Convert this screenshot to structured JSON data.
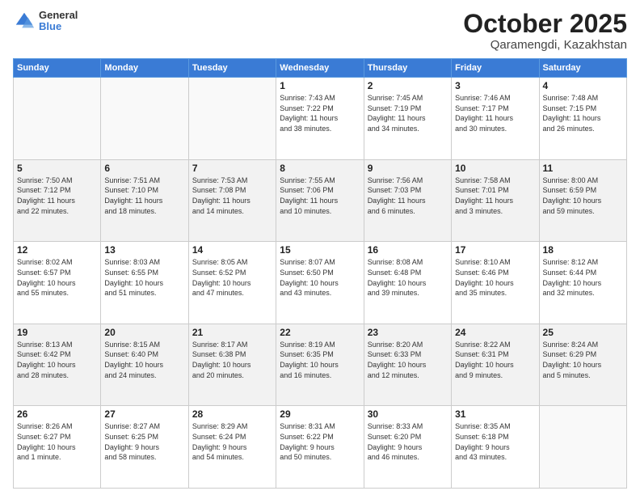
{
  "logo": {
    "general": "General",
    "blue": "Blue"
  },
  "header": {
    "month": "October 2025",
    "location": "Qaramengdi, Kazakhstan"
  },
  "days_of_week": [
    "Sunday",
    "Monday",
    "Tuesday",
    "Wednesday",
    "Thursday",
    "Friday",
    "Saturday"
  ],
  "weeks": [
    [
      {
        "day": "",
        "info": ""
      },
      {
        "day": "",
        "info": ""
      },
      {
        "day": "",
        "info": ""
      },
      {
        "day": "1",
        "info": "Sunrise: 7:43 AM\nSunset: 7:22 PM\nDaylight: 11 hours\nand 38 minutes."
      },
      {
        "day": "2",
        "info": "Sunrise: 7:45 AM\nSunset: 7:19 PM\nDaylight: 11 hours\nand 34 minutes."
      },
      {
        "day": "3",
        "info": "Sunrise: 7:46 AM\nSunset: 7:17 PM\nDaylight: 11 hours\nand 30 minutes."
      },
      {
        "day": "4",
        "info": "Sunrise: 7:48 AM\nSunset: 7:15 PM\nDaylight: 11 hours\nand 26 minutes."
      }
    ],
    [
      {
        "day": "5",
        "info": "Sunrise: 7:50 AM\nSunset: 7:12 PM\nDaylight: 11 hours\nand 22 minutes."
      },
      {
        "day": "6",
        "info": "Sunrise: 7:51 AM\nSunset: 7:10 PM\nDaylight: 11 hours\nand 18 minutes."
      },
      {
        "day": "7",
        "info": "Sunrise: 7:53 AM\nSunset: 7:08 PM\nDaylight: 11 hours\nand 14 minutes."
      },
      {
        "day": "8",
        "info": "Sunrise: 7:55 AM\nSunset: 7:06 PM\nDaylight: 11 hours\nand 10 minutes."
      },
      {
        "day": "9",
        "info": "Sunrise: 7:56 AM\nSunset: 7:03 PM\nDaylight: 11 hours\nand 6 minutes."
      },
      {
        "day": "10",
        "info": "Sunrise: 7:58 AM\nSunset: 7:01 PM\nDaylight: 11 hours\nand 3 minutes."
      },
      {
        "day": "11",
        "info": "Sunrise: 8:00 AM\nSunset: 6:59 PM\nDaylight: 10 hours\nand 59 minutes."
      }
    ],
    [
      {
        "day": "12",
        "info": "Sunrise: 8:02 AM\nSunset: 6:57 PM\nDaylight: 10 hours\nand 55 minutes."
      },
      {
        "day": "13",
        "info": "Sunrise: 8:03 AM\nSunset: 6:55 PM\nDaylight: 10 hours\nand 51 minutes."
      },
      {
        "day": "14",
        "info": "Sunrise: 8:05 AM\nSunset: 6:52 PM\nDaylight: 10 hours\nand 47 minutes."
      },
      {
        "day": "15",
        "info": "Sunrise: 8:07 AM\nSunset: 6:50 PM\nDaylight: 10 hours\nand 43 minutes."
      },
      {
        "day": "16",
        "info": "Sunrise: 8:08 AM\nSunset: 6:48 PM\nDaylight: 10 hours\nand 39 minutes."
      },
      {
        "day": "17",
        "info": "Sunrise: 8:10 AM\nSunset: 6:46 PM\nDaylight: 10 hours\nand 35 minutes."
      },
      {
        "day": "18",
        "info": "Sunrise: 8:12 AM\nSunset: 6:44 PM\nDaylight: 10 hours\nand 32 minutes."
      }
    ],
    [
      {
        "day": "19",
        "info": "Sunrise: 8:13 AM\nSunset: 6:42 PM\nDaylight: 10 hours\nand 28 minutes."
      },
      {
        "day": "20",
        "info": "Sunrise: 8:15 AM\nSunset: 6:40 PM\nDaylight: 10 hours\nand 24 minutes."
      },
      {
        "day": "21",
        "info": "Sunrise: 8:17 AM\nSunset: 6:38 PM\nDaylight: 10 hours\nand 20 minutes."
      },
      {
        "day": "22",
        "info": "Sunrise: 8:19 AM\nSunset: 6:35 PM\nDaylight: 10 hours\nand 16 minutes."
      },
      {
        "day": "23",
        "info": "Sunrise: 8:20 AM\nSunset: 6:33 PM\nDaylight: 10 hours\nand 12 minutes."
      },
      {
        "day": "24",
        "info": "Sunrise: 8:22 AM\nSunset: 6:31 PM\nDaylight: 10 hours\nand 9 minutes."
      },
      {
        "day": "25",
        "info": "Sunrise: 8:24 AM\nSunset: 6:29 PM\nDaylight: 10 hours\nand 5 minutes."
      }
    ],
    [
      {
        "day": "26",
        "info": "Sunrise: 8:26 AM\nSunset: 6:27 PM\nDaylight: 10 hours\nand 1 minute."
      },
      {
        "day": "27",
        "info": "Sunrise: 8:27 AM\nSunset: 6:25 PM\nDaylight: 9 hours\nand 58 minutes."
      },
      {
        "day": "28",
        "info": "Sunrise: 8:29 AM\nSunset: 6:24 PM\nDaylight: 9 hours\nand 54 minutes."
      },
      {
        "day": "29",
        "info": "Sunrise: 8:31 AM\nSunset: 6:22 PM\nDaylight: 9 hours\nand 50 minutes."
      },
      {
        "day": "30",
        "info": "Sunrise: 8:33 AM\nSunset: 6:20 PM\nDaylight: 9 hours\nand 46 minutes."
      },
      {
        "day": "31",
        "info": "Sunrise: 8:35 AM\nSunset: 6:18 PM\nDaylight: 9 hours\nand 43 minutes."
      },
      {
        "day": "",
        "info": ""
      }
    ]
  ]
}
